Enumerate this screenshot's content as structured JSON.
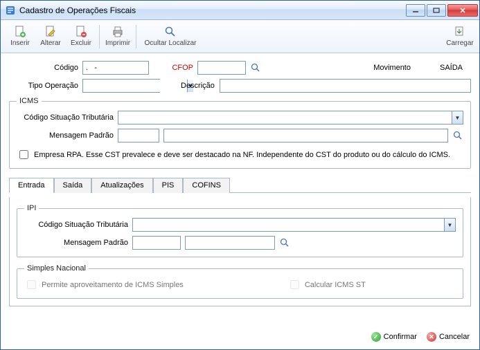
{
  "window": {
    "title": "Cadastro de Operações Fiscais"
  },
  "toolbar": {
    "inserir": "Inserir",
    "alterar": "Alterar",
    "excluir": "Excluir",
    "imprimir": "Imprimir",
    "ocultar": "Ocultar Localizar",
    "carregar": "Carregar"
  },
  "header": {
    "codigo_label": "Código",
    "codigo_value": ".   -",
    "cfop_label": "CFOP",
    "cfop_value": ".",
    "movimento_label": "Movimento",
    "movimento_value": "SAÍDA",
    "tipo_operacao_label": "Tipo Operação",
    "tipo_operacao_value": "",
    "descricao_label": "Descrição",
    "descricao_value": ""
  },
  "icms": {
    "legend": "ICMS",
    "cst_label": "Código Situação Tributária",
    "cst_value": "",
    "msg_label": "Mensagem Padrão",
    "msg_code": "",
    "msg_desc": "",
    "rpa_label": "Empresa RPA. Esse CST prevalece e deve ser destacado na NF. Independente do CST do produto ou do cálculo do ICMS."
  },
  "tabs": {
    "entrada": "Entrada",
    "saida": "Saída",
    "atualizacoes": "Atualizações",
    "pis": "PIS",
    "cofins": "COFINS"
  },
  "ipi": {
    "legend": "IPI",
    "cst_label": "Código Situação Tributária",
    "cst_value": "",
    "msg_label": "Mensagem Padrão",
    "msg_code": "",
    "msg_desc": ""
  },
  "simples": {
    "legend": "Simples Nacional",
    "permite_label": "Permite aproveitamento de ICMS Simples",
    "calcular_label": "Calcular ICMS ST"
  },
  "footer": {
    "confirmar": "Confirmar",
    "cancelar": "Cancelar"
  }
}
